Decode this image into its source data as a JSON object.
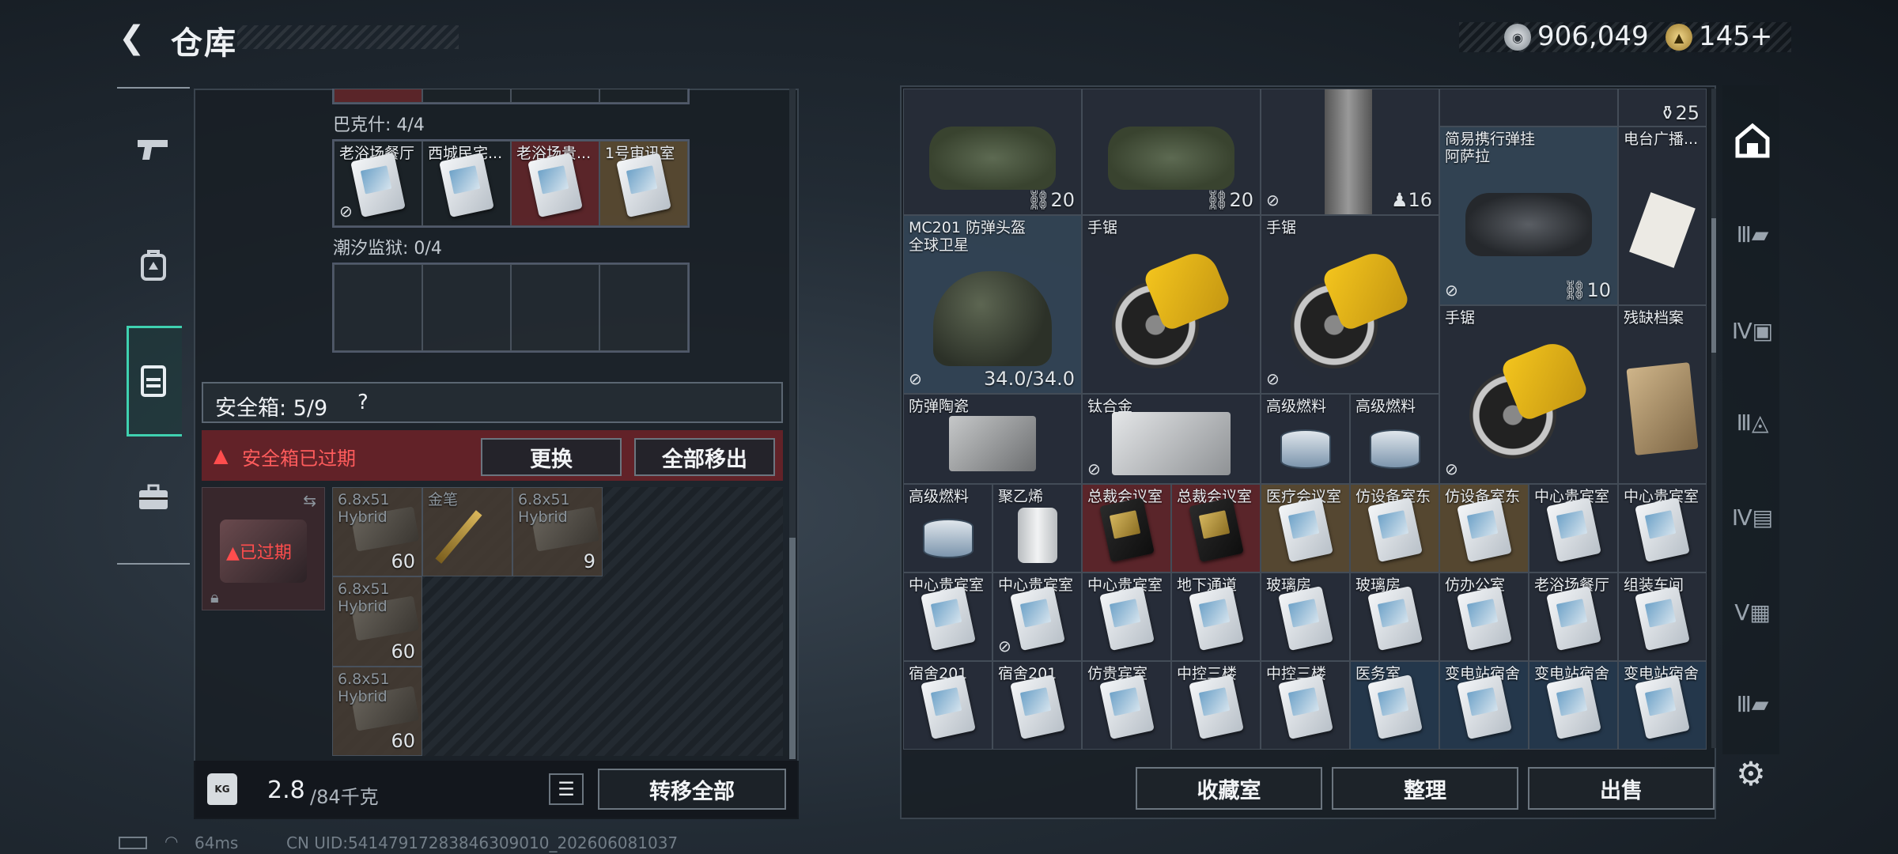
{
  "header": {
    "title": "仓库",
    "currency1": "906,049",
    "currency2": "145+"
  },
  "left_nav": [
    "pistol-icon",
    "backpack-icon",
    "vest-icon",
    "briefcase-icon"
  ],
  "left_panel": {
    "bakeshi_label": "巴克什: 4/4",
    "bakeshi_cells": [
      {
        "name": "老浴场餐厅",
        "style": "dark",
        "nouse": true
      },
      {
        "name": "西城民宅...",
        "style": "dark"
      },
      {
        "name": "老浴场贵...",
        "style": "red"
      },
      {
        "name": "1号审讯室",
        "style": "gold"
      }
    ],
    "tide_label": "潮汐监狱: 0/4",
    "safe_label": "安全箱: 5/9",
    "safe_help": "?",
    "expired_warning": "安全箱已过期",
    "replace_button": "更换",
    "remove_all_button": "全部移出",
    "safe_expired_badge": "已过期",
    "safe_cells": [
      {
        "name": "6.8x51",
        "name2": "Hybrid",
        "count": "60"
      },
      {
        "name": "金笔",
        "name2": "",
        "count": ""
      },
      {
        "name": "6.8x51",
        "name2": "Hybrid",
        "count": "9"
      },
      {
        "name": "6.8x51",
        "name2": "Hybrid",
        "count": "60"
      },
      {
        "name": "6.8x51",
        "name2": "Hybrid",
        "count": "60"
      }
    ],
    "weight_current": "2.8",
    "weight_max": "/84千克",
    "transfer_all_button": "转移全部"
  },
  "right_panel": {
    "items": {
      "bag1_count": "20",
      "bag2_count": "20",
      "pole_count": "16",
      "top_count": "25",
      "simple_rig": "简易携行弹挂",
      "simple_rig2": "阿萨拉",
      "simple_rig_count": "10",
      "radio_doc": "电台广播...",
      "helmet": "MC201 防弹头盔",
      "helmet2": "全球卫星",
      "helmet_durability": "34.0/34.0",
      "saw1": "手锯",
      "saw2": "手锯",
      "saw3": "手锯",
      "broken_file": "残缺档案",
      "ceramic": "防弹陶瓷",
      "titanium": "钛合金",
      "fuel1": "高级燃料",
      "fuel2": "高级燃料",
      "fuel3": "高级燃料",
      "pe": "聚乙烯"
    },
    "card_rows": [
      [
        "总裁会议室",
        "总裁会议室",
        "医疗会议室",
        "仿设备室东",
        "仿设备室东",
        "中心贵宾室",
        "中心贵宾室"
      ],
      [
        "中心贵宾室",
        "中心贵宾室",
        "中心贵宾室",
        "地下通道",
        "玻璃房",
        "玻璃房",
        "仿办公室",
        "老浴场餐厅",
        "组装车间"
      ],
      [
        "宿舍201",
        "宿舍201",
        "仿贵宾室",
        "中控三楼",
        "中控三楼",
        "医务室",
        "变电站宿舍",
        "变电站宿舍",
        "变电站宿舍"
      ]
    ],
    "buttons": {
      "collection": "收藏室",
      "organize": "整理",
      "sell": "出售"
    }
  },
  "status": {
    "ping": "64ms",
    "uid": "CN UID:54147917283846309010_202606081037"
  },
  "colors": {
    "accent": "#3fd1b0",
    "warning": "#ff4d4d",
    "gold": "#d5b65e"
  }
}
